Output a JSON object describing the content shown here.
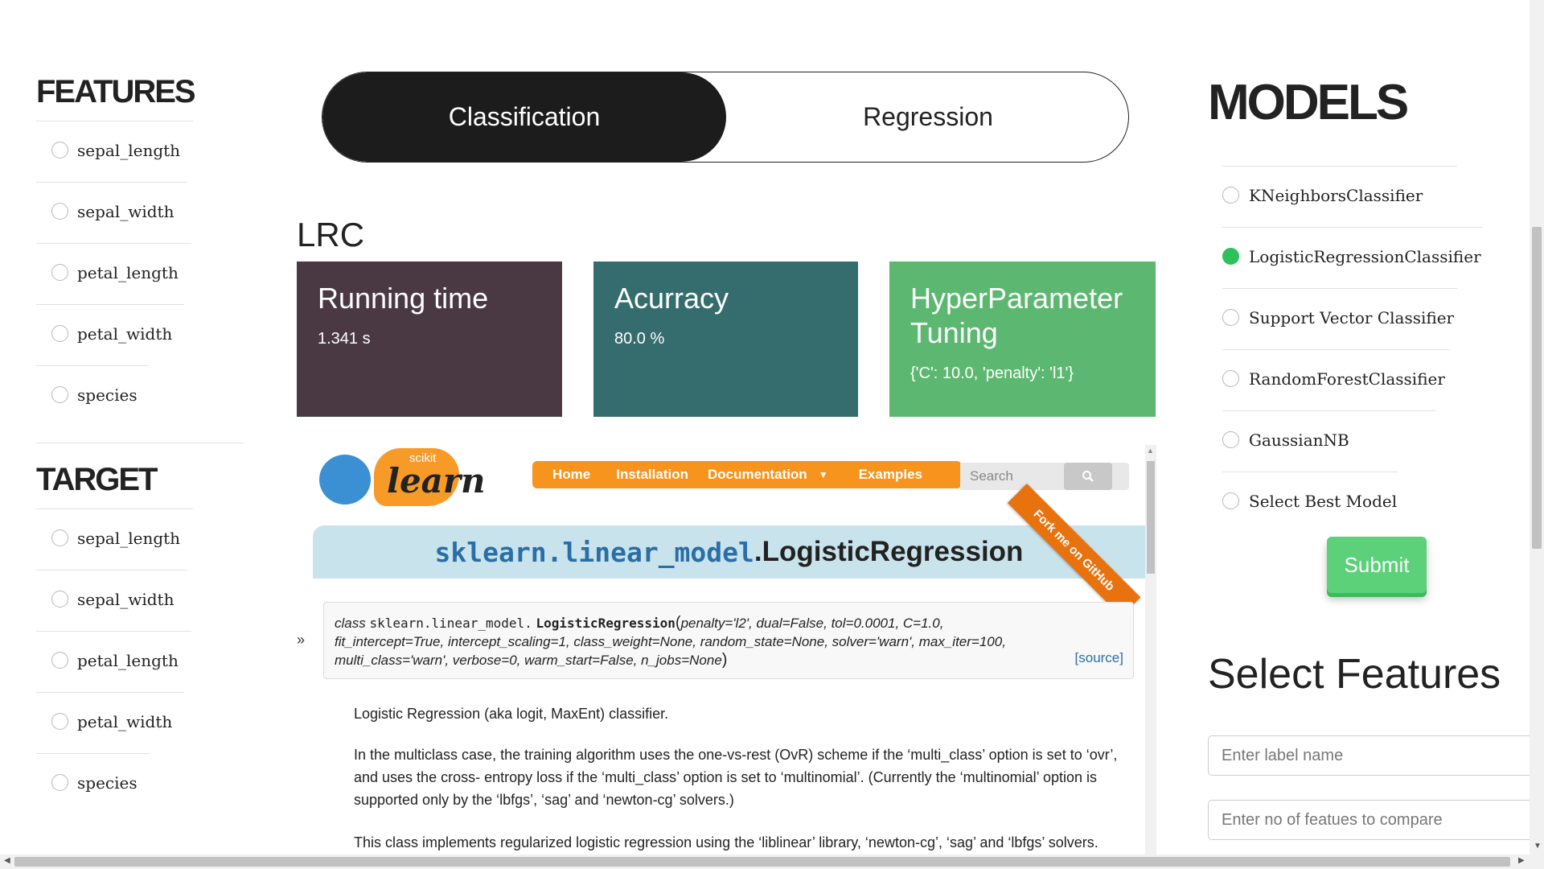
{
  "features": {
    "title": "FEATURES",
    "items": [
      "sepal_length",
      "sepal_width",
      "petal_length",
      "petal_width",
      "species"
    ]
  },
  "target": {
    "title": "TARGET",
    "items": [
      "sepal_length",
      "sepal_width",
      "petal_length",
      "petal_width",
      "species"
    ]
  },
  "toggle": {
    "classification": "Classification",
    "regression": "Regression",
    "active": "Classification"
  },
  "model_short": "LRC",
  "cards": {
    "running_time": {
      "title": "Running time",
      "value": "1.341 s",
      "color": "#4a3943"
    },
    "accuracy": {
      "title": "Acurracy",
      "value": "80.0 %",
      "color": "#356d6e"
    },
    "hyper": {
      "title": "HyperParameter Tuning",
      "value": "{'C': 10.0, 'penalty': 'l1'}",
      "color": "#5cb870"
    }
  },
  "doc": {
    "logo_scikit": "scikit",
    "logo_learn": "learn",
    "nav": {
      "home": "Home",
      "installation": "Installation",
      "documentation": "Documentation",
      "examples": "Examples"
    },
    "search_placeholder": "Search",
    "ribbon": "Fork me on GitHub",
    "title_module": "sklearn.linear_model",
    "title_class": ".LogisticRegression",
    "sig_class_kw": "class",
    "sig_module": "sklearn.linear_model.",
    "sig_name": "LogisticRegression",
    "sig_line1": "penalty='l2', dual=False, tol=0.0001, C=1.0,",
    "sig_line2": "fit_intercept=True, intercept_scaling=1, class_weight=None, random_state=None, solver='warn', max_iter=100,",
    "sig_line3": "multi_class='warn', verbose=0, warm_start=False, n_jobs=None",
    "source_link": "[source]",
    "p1": "Logistic Regression (aka logit, MaxEnt) classifier.",
    "p2": "In the multiclass case, the training algorithm uses the one-vs-rest (OvR) scheme if the ‘multi_class’ option is set to ‘ovr’, and uses the cross- entropy loss if the ‘multi_class’ option is set to ‘multinomial’. (Currently the ‘multinomial’ option is supported only by the ‘lbfgs’, ‘sag’ and ‘newton-cg’ solvers.)",
    "p3": "This class implements regularized logistic regression using the ‘liblinear’ library, ‘newton-cg’, ‘sag’ and ‘lbfgs’ solvers."
  },
  "models": {
    "title": "MODELS",
    "items": [
      "KNeighborsClassifier",
      "LogisticRegressionClassifier",
      "Support Vector Classifier",
      "RandomForestClassifier",
      "GaussianNB",
      "Select Best Model"
    ],
    "selected": "LogisticRegressionClassifier",
    "submit": "Submit"
  },
  "select_features": {
    "title": "Select Features",
    "label_placeholder": "Enter label name",
    "count_placeholder": "Enter no of featues to compare"
  }
}
